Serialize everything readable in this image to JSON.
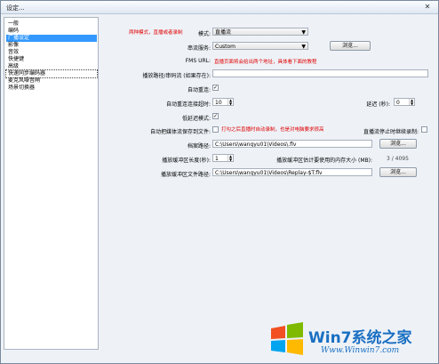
{
  "window": {
    "title": "设定...",
    "close_glyph": "✕"
  },
  "sidebar": {
    "items": [
      {
        "label": "一般"
      },
      {
        "label": "编码"
      },
      {
        "label": "广播设定"
      },
      {
        "label": "影像"
      },
      {
        "label": "音效"
      },
      {
        "label": "快捷键"
      },
      {
        "label": "高级"
      },
      {
        "label": "快速同步编码器"
      },
      {
        "label": "麦克风噪音闸"
      },
      {
        "label": "场景切换器"
      }
    ],
    "selected_index": 2
  },
  "annotations": {
    "mode_note": "两种模式，直播或者录制",
    "fms_note": "直播页面将会给出两个地址，具体看下面的教程",
    "save_note": "打勾之后直播时自动录制，也是对电脑要求很高"
  },
  "form": {
    "mode_label": "模式:",
    "mode_value": "直播流",
    "service_label": "串流服务:",
    "service_value": "Custom",
    "browse_label": "浏览...",
    "fms_label": "FMS URL:",
    "fms_value": "",
    "playpath_label": "播放路径/串码流 (如果存在):",
    "playpath_value": "",
    "auto_reconnect_label": "自动重连:",
    "auto_reconnect_checked": true,
    "reconnect_timeout_label": "自动重连连接超时:",
    "reconnect_timeout_value": "10",
    "delay_label": "延迟 (秒):",
    "delay_value": "0",
    "low_latency_label": "低延迟模式:",
    "low_latency_checked": true,
    "auto_save_label": "自动把媒体流保存到文件:",
    "auto_save_checked": false,
    "stop_on_end_label": "直播流停止时继续录制:",
    "stop_on_end_checked": false,
    "file_path_label": "档案路径:",
    "file_path_value": "C:\\Users\\wangyu01\\Videos\\.flv",
    "replay_len_label": "播放缓冲区长度(秒):",
    "replay_len_value": "1",
    "replay_mem_label": "播放缓冲区估计要使用的内存大小 (MB):",
    "replay_mem_value": "3 / 4095",
    "replay_path_label": "播放缓冲区文件路径:",
    "replay_path_value": "C:\\Users\\wangyu01\\Videos\\Replay-$T.flv",
    "checked_glyph": "✓",
    "combo_arrow": "▼"
  },
  "watermark": {
    "text": "Win7系统之家",
    "url": "Www.Winwin7.com"
  }
}
